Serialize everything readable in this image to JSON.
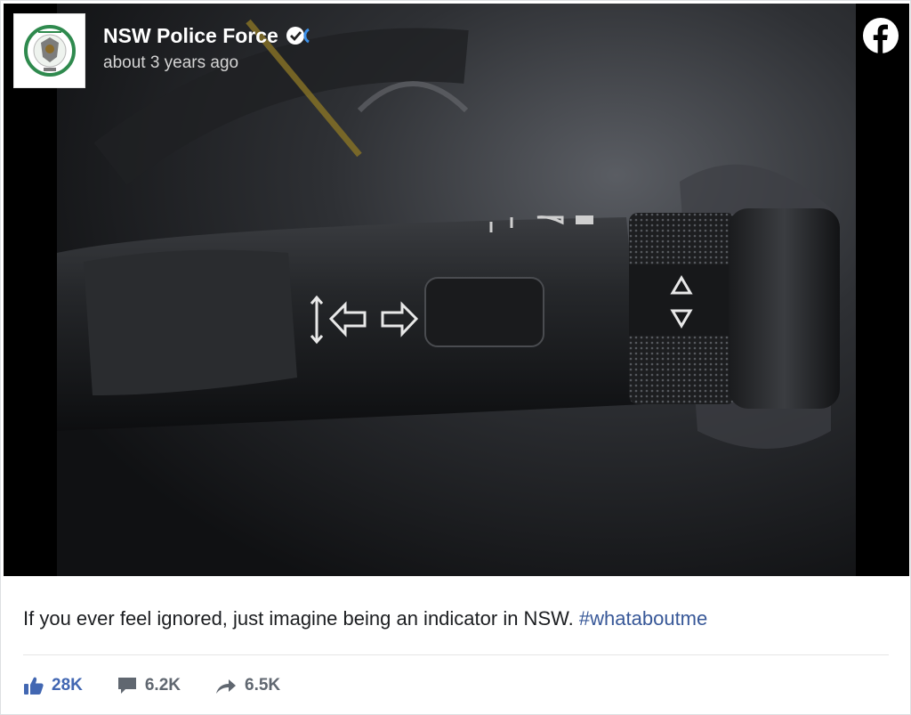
{
  "post": {
    "page_name": "NSW Police Force",
    "timestamp": "about 3 years ago",
    "caption": "If you ever feel ignored, just imagine being an indicator in NSW.",
    "hashtag": "#whataboutme",
    "stats": {
      "likes": "28K",
      "comments": "6.2K",
      "shares": "6.5K"
    }
  },
  "icons": {
    "verified": "verified-badge-icon",
    "facebook": "facebook-logo-icon",
    "like": "thumbs-up-icon",
    "comment": "comment-bubble-icon",
    "share": "share-arrow-icon"
  },
  "colors": {
    "like": "#4267b2",
    "hashtag": "#385898",
    "muted": "#606770"
  }
}
